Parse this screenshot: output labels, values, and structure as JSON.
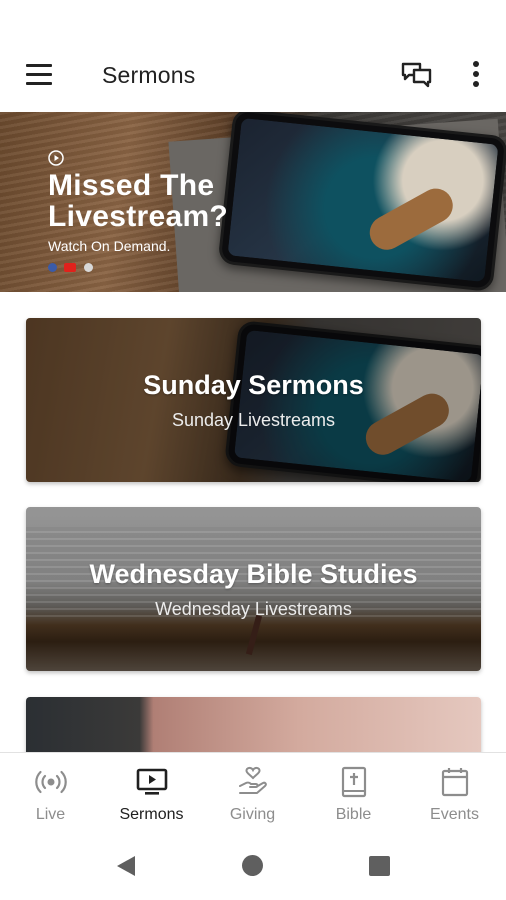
{
  "app_bar": {
    "title": "Sermons",
    "icons": [
      "menu-icon",
      "chat-icon",
      "more-vert-icon"
    ]
  },
  "hero": {
    "headline": "Missed The Livestream?",
    "subtitle": "Watch On Demand.",
    "social_icons": [
      "facebook-icon",
      "youtube-icon",
      "web-icon"
    ]
  },
  "cards": [
    {
      "title": "Sunday Sermons",
      "subtitle": "Sunday Livestreams"
    },
    {
      "title": "Wednesday Bible Studies",
      "subtitle": "Wednesday Livestreams"
    }
  ],
  "bottom_nav": {
    "items": [
      {
        "label": "Live",
        "icon": "live-broadcast-icon"
      },
      {
        "label": "Sermons",
        "icon": "tv-play-icon",
        "active": true
      },
      {
        "label": "Giving",
        "icon": "hand-heart-icon"
      },
      {
        "label": "Bible",
        "icon": "bible-icon"
      },
      {
        "label": "Events",
        "icon": "calendar-icon"
      }
    ],
    "active_color": "#202020",
    "inactive_color": "#8d8d8d"
  },
  "system_nav": [
    "back-icon",
    "home-icon",
    "recents-icon"
  ]
}
